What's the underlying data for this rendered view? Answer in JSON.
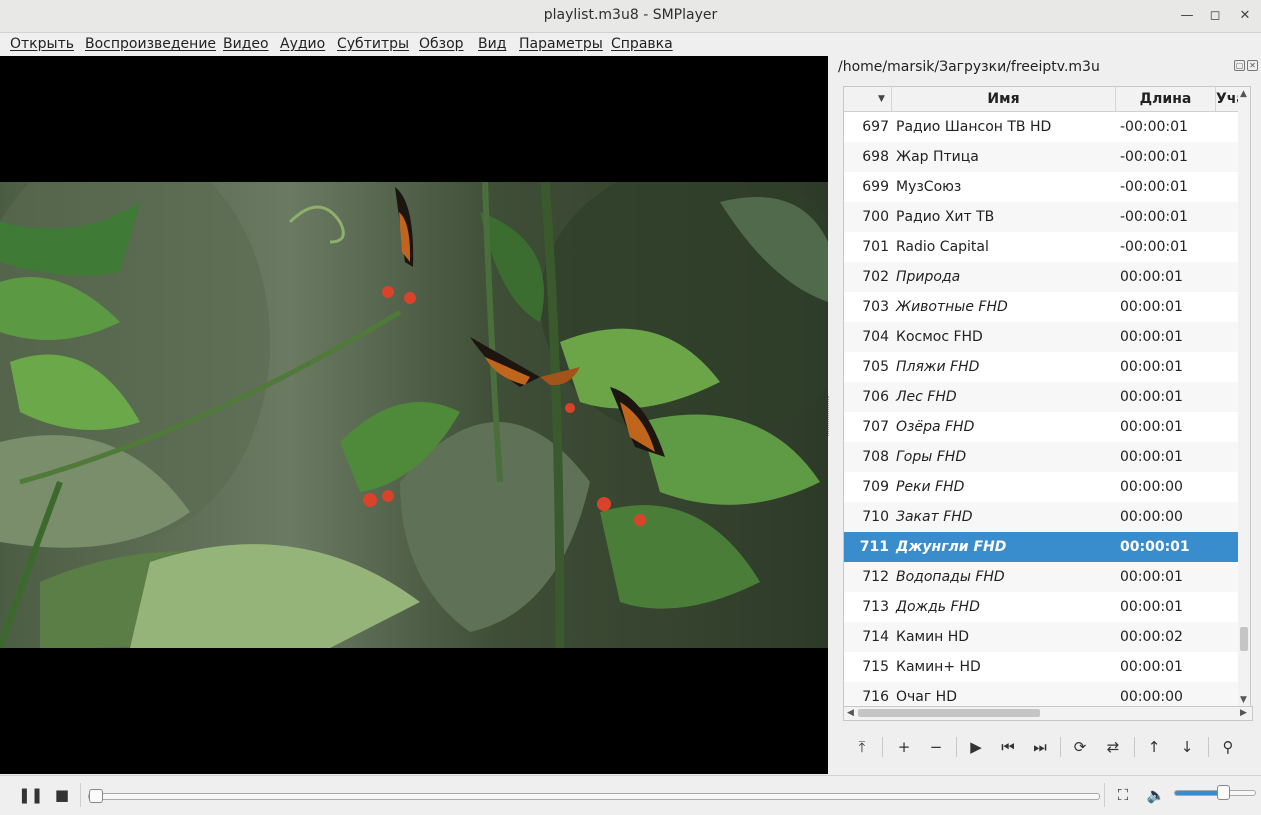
{
  "window": {
    "title": "playlist.m3u8 - SMPlayer"
  },
  "menu": [
    "Открыть",
    "Воспроизведение",
    "Видео",
    "Аудио",
    "Субтитры",
    "Обзор",
    "Вид",
    "Параметры",
    "Справка"
  ],
  "playlist": {
    "path": "/home/marsik/Загрузки/freeiptv.m3u",
    "columns": {
      "name": "Имя",
      "length": "Длина",
      "extra": "Уча"
    },
    "selected_color": "#3a8dcc",
    "rows": [
      {
        "num": "697",
        "name": "Радио Шансон ТВ HD",
        "length": "-00:00:01",
        "italic": false
      },
      {
        "num": "698",
        "name": "Жар Птица",
        "length": "-00:00:01",
        "italic": false
      },
      {
        "num": "699",
        "name": "МузСоюз",
        "length": "-00:00:01",
        "italic": false
      },
      {
        "num": "700",
        "name": "Радио Хит ТВ",
        "length": "-00:00:01",
        "italic": false
      },
      {
        "num": "701",
        "name": "Radio Capital",
        "length": "-00:00:01",
        "italic": false
      },
      {
        "num": "702",
        "name": "Природа",
        "length": "00:00:01",
        "italic": true
      },
      {
        "num": "703",
        "name": "Животные FHD",
        "length": "00:00:01",
        "italic": true
      },
      {
        "num": "704",
        "name": "Космос FHD",
        "length": "00:00:01",
        "italic": false
      },
      {
        "num": "705",
        "name": "Пляжи FHD",
        "length": "00:00:01",
        "italic": true
      },
      {
        "num": "706",
        "name": "Лес FHD",
        "length": "00:00:01",
        "italic": true
      },
      {
        "num": "707",
        "name": "Озёра FHD",
        "length": "00:00:01",
        "italic": true
      },
      {
        "num": "708",
        "name": "Горы FHD",
        "length": "00:00:01",
        "italic": true
      },
      {
        "num": "709",
        "name": "Реки FHD",
        "length": "00:00:00",
        "italic": true
      },
      {
        "num": "710",
        "name": "Закат FHD",
        "length": "00:00:00",
        "italic": true
      },
      {
        "num": "711",
        "name": "Джунгли FHD",
        "length": "00:00:01",
        "italic": true,
        "selected": true
      },
      {
        "num": "712",
        "name": "Водопады FHD",
        "length": "00:00:01",
        "italic": true
      },
      {
        "num": "713",
        "name": "Дождь FHD",
        "length": "00:00:01",
        "italic": true
      },
      {
        "num": "714",
        "name": "Камин HD",
        "length": "00:00:02",
        "italic": false
      },
      {
        "num": "715",
        "name": "Камин+ HD",
        "length": "00:00:01",
        "italic": false
      },
      {
        "num": "716",
        "name": "Очаг HD",
        "length": "00:00:00",
        "italic": false
      }
    ]
  },
  "playback": {
    "progress_fraction": 0.0,
    "volume_fraction": 0.6
  }
}
